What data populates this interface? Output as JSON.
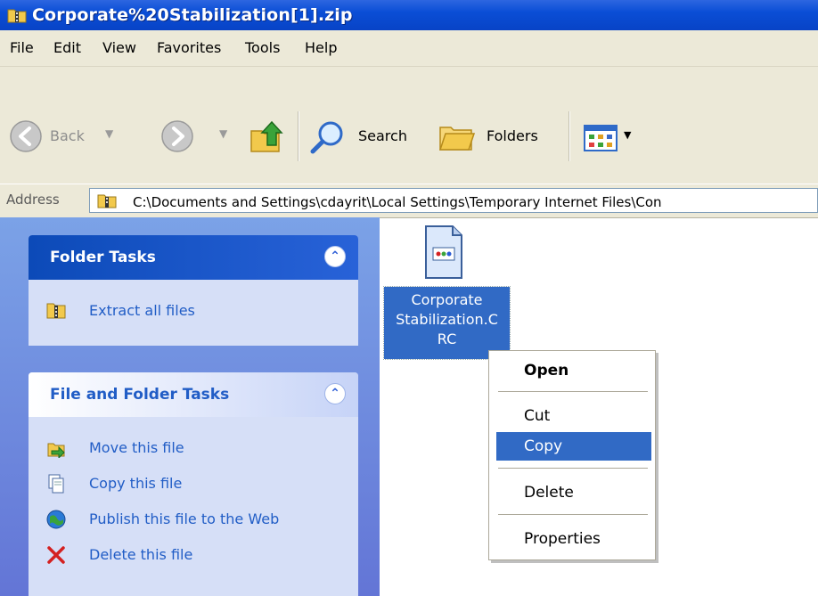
{
  "window": {
    "title": "Corporate%20Stabilization[1].zip"
  },
  "menu": [
    "File",
    "Edit",
    "View",
    "Favorites",
    "Tools",
    "Help"
  ],
  "toolbar": {
    "back_label": "Back",
    "search_label": "Search",
    "folders_label": "Folders"
  },
  "address": {
    "label": "Address",
    "value": "C:\\Documents and Settings\\cdayrit\\Local Settings\\Temporary Internet Files\\Con"
  },
  "folder_tasks": {
    "title": "Folder Tasks",
    "items": [
      {
        "label": "Extract all files",
        "icon": "zip-folder-icon"
      }
    ]
  },
  "file_folder_tasks": {
    "title": "File and Folder Tasks",
    "items": [
      {
        "label": "Move this file",
        "icon": "move-file-icon"
      },
      {
        "label": "Copy this file",
        "icon": "copy-file-icon"
      },
      {
        "label": "Publish this file to the Web",
        "icon": "publish-web-icon"
      },
      {
        "label": "Delete this file",
        "icon": "delete-icon"
      }
    ]
  },
  "file": {
    "label_lines": [
      "Corporate",
      "Stabilization.C",
      "RC"
    ]
  },
  "context_menu": {
    "items": [
      "Open",
      "Cut",
      "Copy",
      "Delete",
      "Properties"
    ],
    "highlighted": "Copy"
  },
  "colors": {
    "titlebar": "#0a4ed6",
    "selection": "#316ac5",
    "taskpane": "#6d8ee0",
    "panel_body": "#d6dff7",
    "panel_link": "#215dc6"
  }
}
